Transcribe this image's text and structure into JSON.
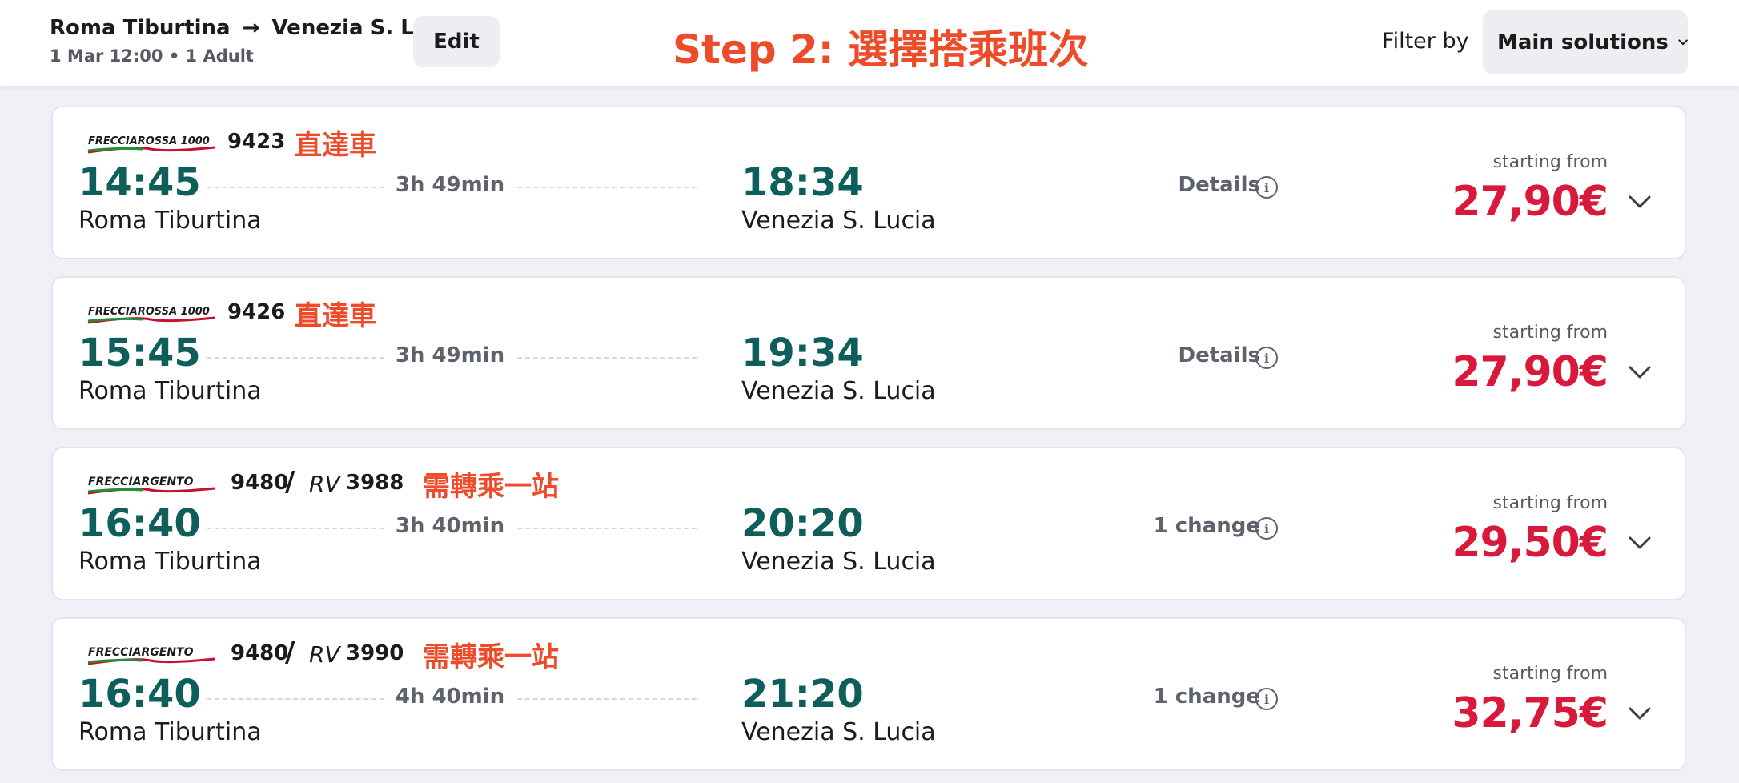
{
  "header": {
    "origin": "Roma Tiburtina",
    "arrow": "→",
    "destination": "Venezia S. Lucia",
    "subinfo": "1 Mar 12:00 • 1 Adult",
    "edit_label": "Edit",
    "step_title": "Step 2: 選擇搭乘班次",
    "filter_label": "Filter by",
    "filter_value": "Main solutions"
  },
  "brand": {
    "logo_frecciarossa": "FRECCIAROSSA 1000",
    "logo_frecciargento": "FRECCIARGENTO",
    "logo_rv": "RV"
  },
  "colors": {
    "accent_red": "#d9193b",
    "time_teal": "#0e5e5c",
    "annotation_red": "#ee4b2b",
    "logo_green": "#1f8f3a",
    "logo_red": "#c8102e"
  },
  "solutions": [
    {
      "train_no": "9423",
      "note": "直達車",
      "dep_time": "14:45",
      "dep_station": "Roma Tiburtina",
      "duration": "3h 49min",
      "arr_time": "18:34",
      "arr_station": "Venezia S. Lucia",
      "info": "Details",
      "starting_label": "starting from",
      "price": "27,90€"
    },
    {
      "train_no": "9426",
      "note": "直達車",
      "dep_time": "15:45",
      "dep_station": "Roma Tiburtina",
      "duration": "3h 49min",
      "arr_time": "19:34",
      "arr_station": "Venezia S. Lucia",
      "info": "Details",
      "starting_label": "starting from",
      "price": "27,90€"
    },
    {
      "train_no": "9480",
      "slash": "/",
      "rv_no": "3988",
      "note": "需轉乘一站",
      "dep_time": "16:40",
      "dep_station": "Roma Tiburtina",
      "duration": "3h 40min",
      "arr_time": "20:20",
      "arr_station": "Venezia S. Lucia",
      "info": "1 change",
      "starting_label": "starting from",
      "price": "29,50€"
    },
    {
      "train_no": "9480",
      "slash": "/",
      "rv_no": "3990",
      "note": "需轉乘一站",
      "dep_time": "16:40",
      "dep_station": "Roma Tiburtina",
      "duration": "4h 40min",
      "arr_time": "21:20",
      "arr_station": "Venezia S. Lucia",
      "info": "1 change",
      "starting_label": "starting from",
      "price": "32,75€"
    }
  ]
}
